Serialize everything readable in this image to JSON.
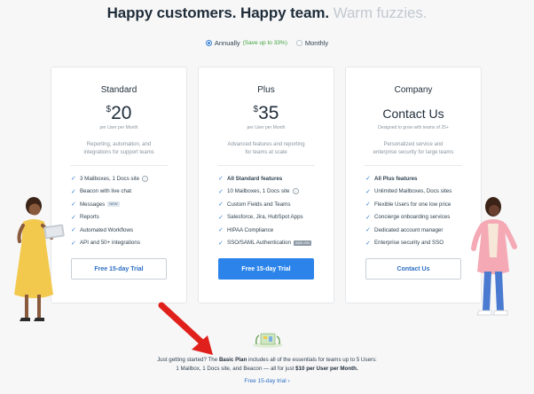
{
  "headline": {
    "main": "Happy customers. Happy team.",
    "muted": "Warm fuzzies."
  },
  "billing": {
    "annually_label": "Annually",
    "annually_save": "(Save up to 33%)",
    "monthly_label": "Monthly",
    "selected": "Annually"
  },
  "plans": [
    {
      "name": "Standard",
      "currency": "$",
      "price": "20",
      "per": "per User per Month",
      "description": [
        "Reporting, automation, and",
        "integrations for support teams"
      ],
      "features": [
        {
          "text": "3 Mailboxes, 1 Docs site",
          "info": true
        },
        {
          "text": "Beacon with live chat"
        },
        {
          "text": "Messages",
          "tag": "NEW"
        },
        {
          "text": "Reports"
        },
        {
          "text": "Automated Workflows"
        },
        {
          "text": "API and 50+ integrations"
        }
      ],
      "cta": "Free 15-day Trial"
    },
    {
      "name": "Plus",
      "currency": "$",
      "price": "35",
      "per": "per User per Month",
      "description": [
        "Advanced features and reporting",
        "for teams at scale"
      ],
      "features": [
        {
          "text": "All Standard features",
          "bold": true
        },
        {
          "text": "10 Mailboxes, 1 Docs site",
          "info": true
        },
        {
          "text": "Custom Fields and Teams"
        },
        {
          "text": "Salesforce, Jira, HubSpot Apps"
        },
        {
          "text": "HIPAA Compliance"
        },
        {
          "text": "SSO/SAML Authentication",
          "tag": "ADD-ON"
        }
      ],
      "cta": "Free 15-day Trial"
    },
    {
      "name": "Company",
      "contact": "Contact Us",
      "per": "Designed to grow with teams of 25+",
      "description": [
        "Personalized service and",
        "enterprise security for large teams"
      ],
      "features": [
        {
          "text": "All Plus features",
          "bold": true
        },
        {
          "text": "Unlimited Mailboxes, Docs sites"
        },
        {
          "text": "Flexible Users for one low price"
        },
        {
          "text": "Concierge onboarding services"
        },
        {
          "text": "Dedicated account manager"
        },
        {
          "text": "Enterprise security and SSO"
        }
      ],
      "cta": "Contact Us"
    }
  ],
  "basic": {
    "line1_prefix": "Just getting started? The",
    "line1_plan": "Basic Plan",
    "line1_suffix": "includes all of the essentials for teams up to 5 Users:",
    "line2_prefix": "1 Mailbox, 1 Docs site, and Beacon — all for just",
    "line2_price": "$10 per User per Month.",
    "link": "Free 15-day trial ›"
  },
  "colors": {
    "accent": "#2c84ea",
    "link": "#2d6fc4",
    "check": "#3a82d6",
    "save_green": "#3fa33a",
    "annotation_arrow": "#e0201b"
  },
  "icons": {
    "feature": "check-icon",
    "info": "info-icon",
    "annotation": "red-arrow-icon"
  }
}
